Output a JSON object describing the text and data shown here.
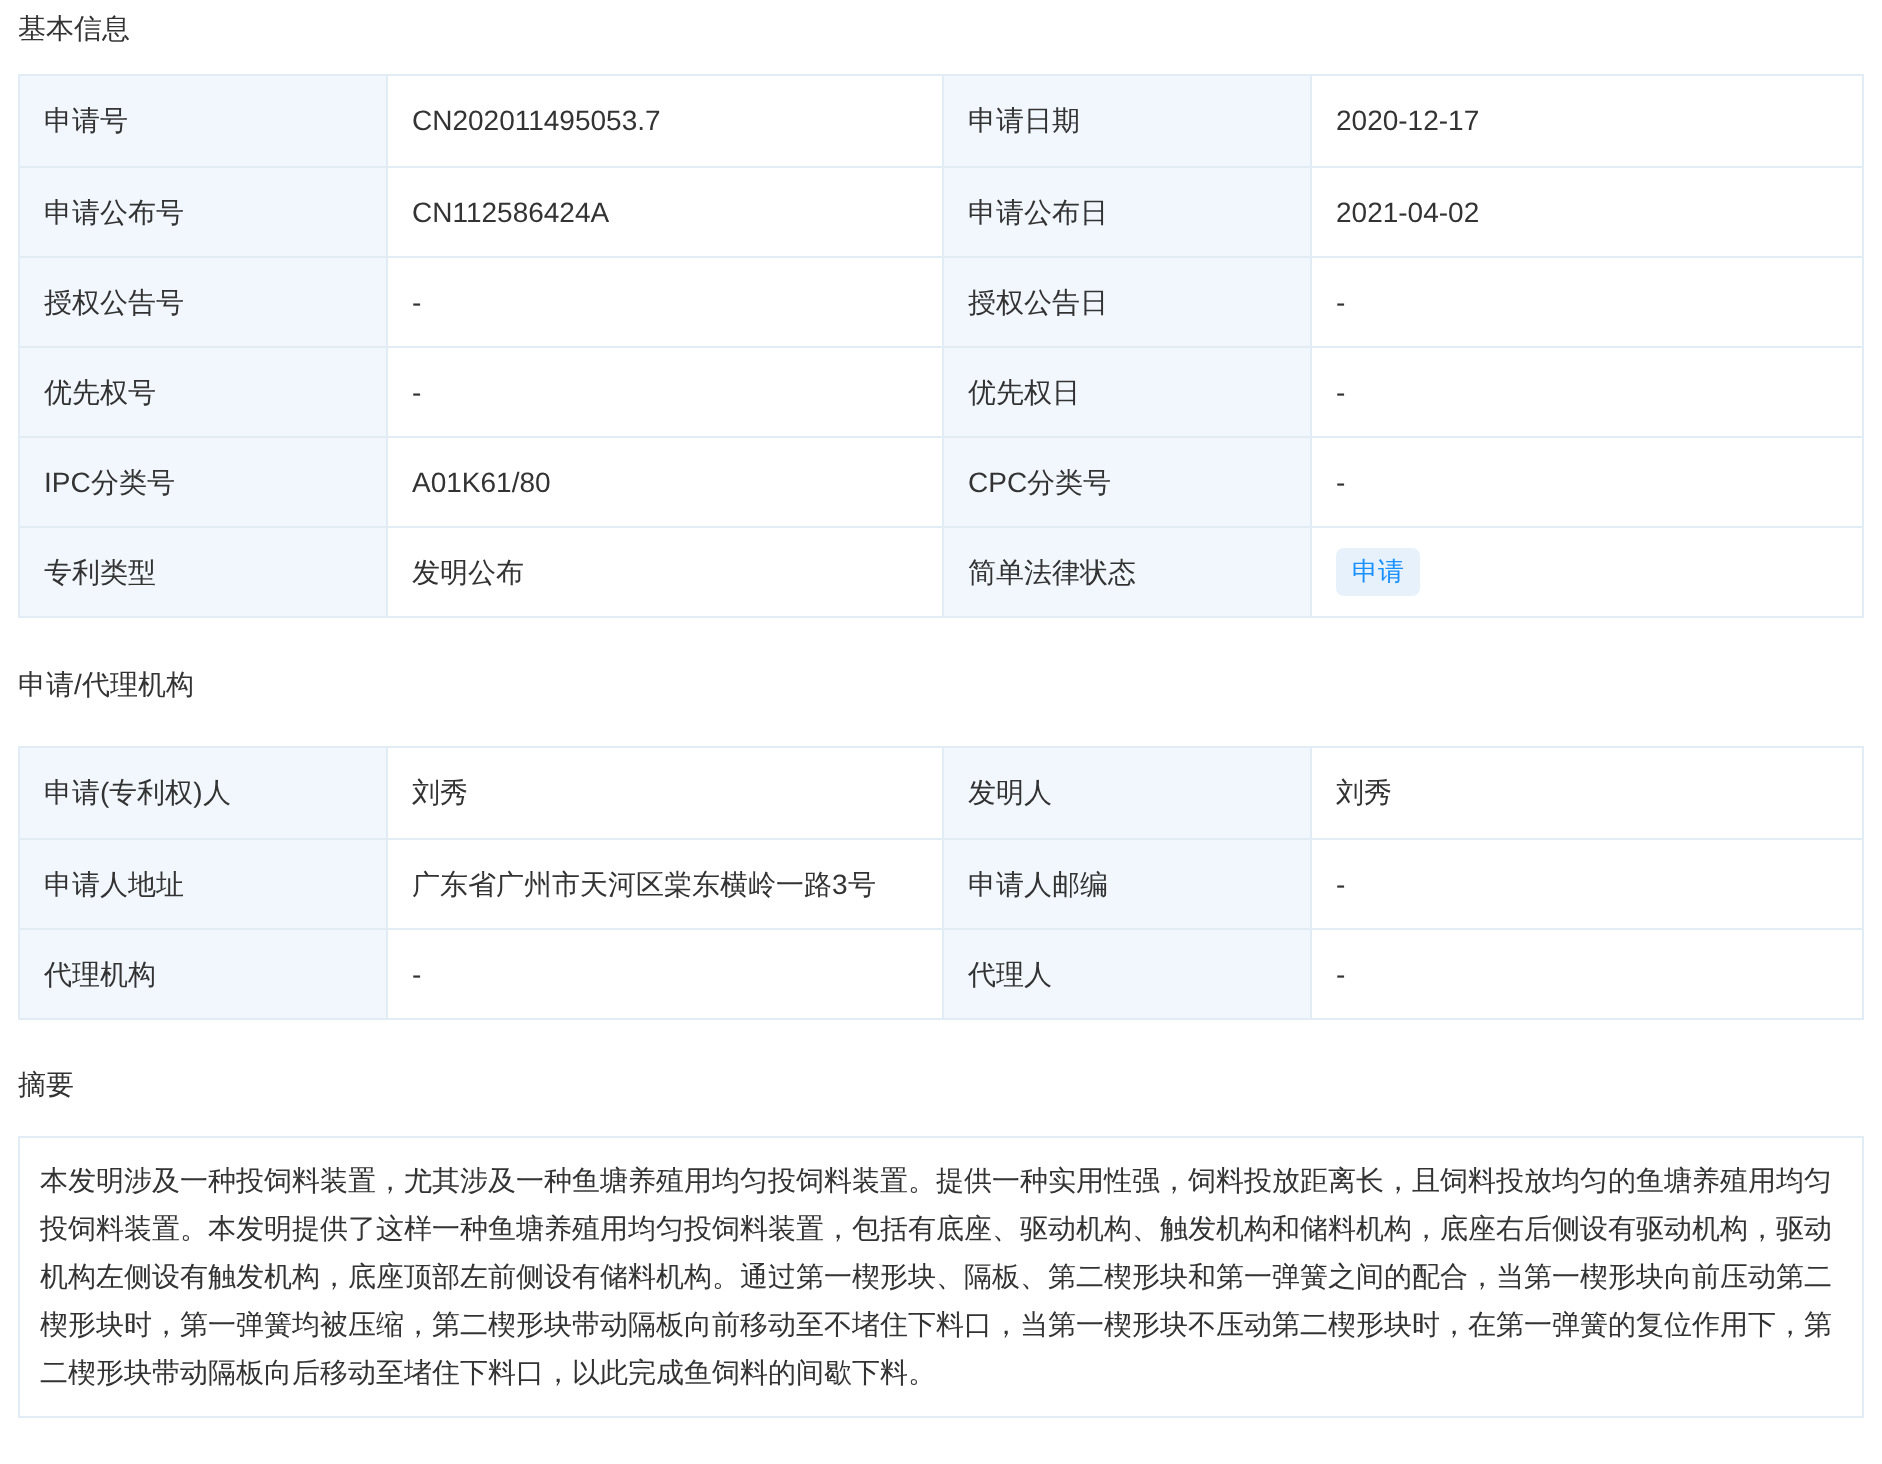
{
  "basic_info": {
    "title": "基本信息",
    "rows": [
      [
        {
          "label": "申请号",
          "value": "CN202011495053.7",
          "kind": "text"
        },
        {
          "label": "申请日期",
          "value": "2020-12-17",
          "kind": "text"
        }
      ],
      [
        {
          "label": "申请公布号",
          "value": "CN112586424A",
          "kind": "text"
        },
        {
          "label": "申请公布日",
          "value": "2021-04-02",
          "kind": "text"
        }
      ],
      [
        {
          "label": "授权公告号",
          "value": "-",
          "kind": "text"
        },
        {
          "label": "授权公告日",
          "value": "-",
          "kind": "text"
        }
      ],
      [
        {
          "label": "优先权号",
          "value": "-",
          "kind": "text"
        },
        {
          "label": "优先权日",
          "value": "-",
          "kind": "text"
        }
      ],
      [
        {
          "label": "IPC分类号",
          "value": "A01K61/80",
          "kind": "text"
        },
        {
          "label": "CPC分类号",
          "value": "-",
          "kind": "text"
        }
      ],
      [
        {
          "label": "专利类型",
          "value": "发明公布",
          "kind": "text"
        },
        {
          "label": "简单法律状态",
          "value": "申请",
          "kind": "badge"
        }
      ]
    ]
  },
  "applicant_agency": {
    "title": "申请/代理机构",
    "rows": [
      [
        {
          "label": "申请(专利权)人",
          "value": "刘秀",
          "kind": "text"
        },
        {
          "label": "发明人",
          "value": "刘秀",
          "kind": "text"
        }
      ],
      [
        {
          "label": "申请人地址",
          "value": "广东省广州市天河区棠东横岭一路3号",
          "kind": "text"
        },
        {
          "label": "申请人邮编",
          "value": "-",
          "kind": "text"
        }
      ],
      [
        {
          "label": "代理机构",
          "value": "-",
          "kind": "text"
        },
        {
          "label": "代理人",
          "value": "-",
          "kind": "text"
        }
      ]
    ]
  },
  "abstract": {
    "title": "摘要",
    "text": "本发明涉及一种投饲料装置，尤其涉及一种鱼塘养殖用均匀投饲料装置。提供一种实用性强，饲料投放距离长，且饲料投放均匀的鱼塘养殖用均匀投饲料装置。本发明提供了这样一种鱼塘养殖用均匀投饲料装置，包括有底座、驱动机构、触发机构和储料机构，底座右后侧设有驱动机构，驱动机构左侧设有触发机构，底座顶部左前侧设有储料机构。通过第一楔形块、隔板、第二楔形块和第一弹簧之间的配合，当第一楔形块向前压动第二楔形块时，第一弹簧均被压缩，第二楔形块带动隔板向前移动至不堵住下料口，当第一楔形块不压动第二楔形块时，在第一弹簧的复位作用下，第二楔形块带动隔板向后移动至堵住下料口，以此完成鱼饲料的间歇下料。"
  }
}
